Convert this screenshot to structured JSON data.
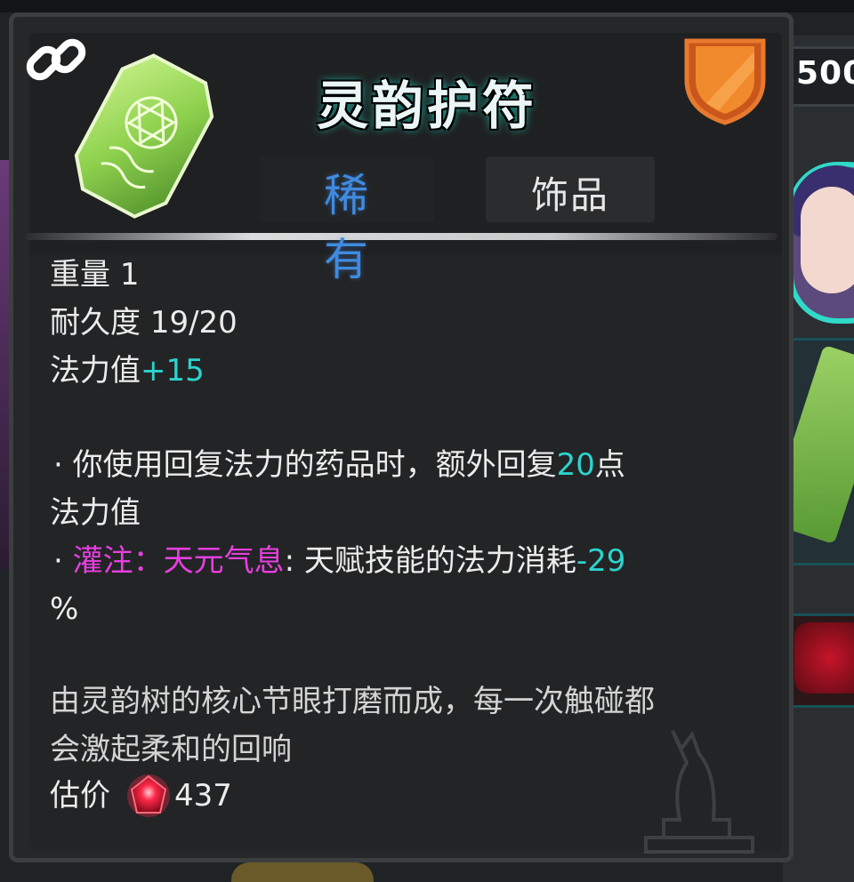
{
  "background": {
    "gold_amount": "500"
  },
  "item": {
    "name": "灵韵护符",
    "rarity": "稀有",
    "type": "饰品",
    "rarity_color": "#3f8be0",
    "icon": "jade-amulet-icon",
    "badge_icon": "orange-shield-badge-icon",
    "link_icon": "chain-link-icon"
  },
  "stats": {
    "weight_label": "重量",
    "weight_value": "1",
    "durability_label": "耐久度",
    "durability_value": "19/20",
    "mana_label": "法力值",
    "mana_bonus": "+15"
  },
  "effects": {
    "effect1_prefix": "· 你使用回复法力的药品时，额外回复",
    "effect1_value": "20",
    "effect1_suffix": "点",
    "effect1_line2": "法力值",
    "effect2_bullet": "·",
    "effect2_name": "灌注：天元气息",
    "effect2_text": ": 天赋技能的法力消耗",
    "effect2_value": "-29",
    "effect2_unit": "%"
  },
  "lore": {
    "line1": "由灵韵树的核心节眼打磨而成，每一次触碰都",
    "line2": "会激起柔和的回响"
  },
  "price": {
    "label": "估价",
    "value": "437",
    "icon": "red-gem-currency-icon"
  },
  "colors": {
    "highlight_cyan": "#2bd4cf",
    "infusion_magenta": "#e63fe0",
    "title_glow": "#1ee6ce"
  }
}
